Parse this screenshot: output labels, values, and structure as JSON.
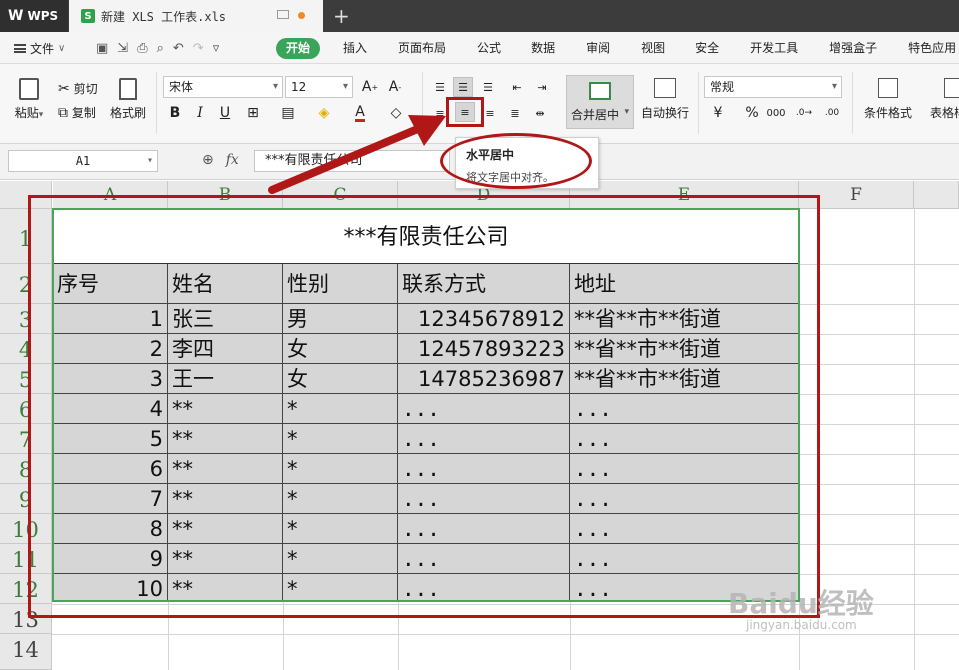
{
  "titlebar": {
    "app_logo": "WPS",
    "doc_tab": "新建 XLS 工作表.xls",
    "tab_icon_letter": "S",
    "new_tab": "+"
  },
  "menubar": {
    "file": "文件",
    "items": [
      "开始",
      "插入",
      "页面布局",
      "公式",
      "数据",
      "审阅",
      "视图",
      "安全",
      "开发工具",
      "增强盒子",
      "特色应用"
    ],
    "active": "开始"
  },
  "ribbon": {
    "paste": "粘贴",
    "cut": "剪切",
    "copy": "复制",
    "format_painter": "格式刷",
    "font_name": "宋体",
    "font_size": "12",
    "merge_center": "合并居中",
    "wrap_text": "自动换行",
    "number_format": "常规",
    "conditional_format": "条件格式",
    "table_style": "表格样式",
    "bold": "B",
    "italic": "I",
    "underline": "U",
    "font_color_letter": "A",
    "percent": "%"
  },
  "formula_bar": {
    "name_box": "A1",
    "fx": "fx",
    "content": "***有限责任公司"
  },
  "tooltip": {
    "title": "水平居中",
    "description": "将文字居中对齐。"
  },
  "sheet": {
    "columns": [
      "A",
      "B",
      "C",
      "D",
      "E",
      "F"
    ],
    "rows": [
      "1",
      "2",
      "3",
      "4",
      "5",
      "6",
      "7",
      "8",
      "9",
      "10",
      "11",
      "12",
      "13",
      "14"
    ],
    "title": "***有限责任公司",
    "headers": [
      "序号",
      "姓名",
      "性别",
      "联系方式",
      "地址"
    ],
    "data": [
      [
        "1",
        "张三",
        "男",
        "12345678912",
        "**省**市**街道"
      ],
      [
        "2",
        "李四",
        "女",
        "12457893223",
        "**省**市**街道"
      ],
      [
        "3",
        "王一",
        "女",
        "14785236987",
        "**省**市**街道"
      ],
      [
        "4",
        "**",
        "*",
        "...",
        "..."
      ],
      [
        "5",
        "**",
        "*",
        "...",
        "..."
      ],
      [
        "6",
        "**",
        "*",
        "...",
        "..."
      ],
      [
        "7",
        "**",
        "*",
        "...",
        "..."
      ],
      [
        "8",
        "**",
        "*",
        "...",
        "..."
      ],
      [
        "9",
        "**",
        "*",
        "...",
        "..."
      ],
      [
        "10",
        "**",
        "*",
        "...",
        "..."
      ]
    ]
  },
  "watermark": {
    "brand": "Baidu经验",
    "url": "jingyan.baidu.com"
  },
  "colors": {
    "accent_green": "#3aa55a",
    "annotation_red": "#b01818",
    "cell_fill": "#d6d6d6"
  }
}
